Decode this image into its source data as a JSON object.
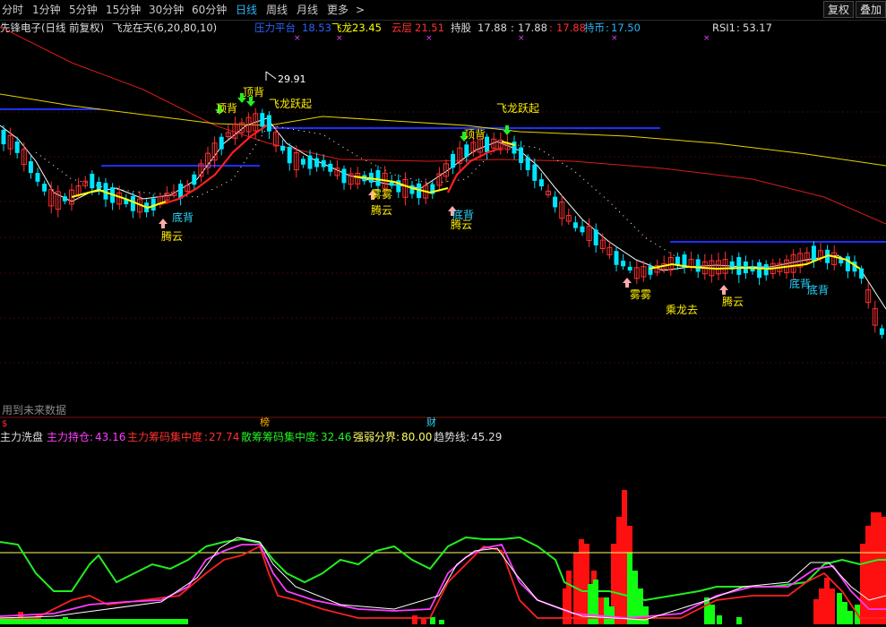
{
  "toolbar": {
    "periods": [
      "分时",
      "1分钟",
      "5分钟",
      "15分钟",
      "30分钟",
      "60分钟",
      "日线",
      "周线",
      "月线",
      "更多"
    ],
    "more_arrow": ">",
    "active_period": "日线",
    "restore_button": "复权",
    "overlay_button": "叠加"
  },
  "main": {
    "stock_title": "先锋电子(日线 前复权)",
    "indicator_name": "飞龙在天(6,20,80,10)",
    "values": {
      "pressure_label": "压力平台",
      "pressure_value": "18.53",
      "feilong_label": "飞龙",
      "feilong_value": "23.45",
      "yunceng_label": "云层",
      "yunceng_value": "21.51",
      "chigu_label": "持股",
      "chigu_value": "17.88",
      "chigu_value2": "17.88",
      "chigu_value3": "17.88",
      "chibi_label": "持币",
      "chibi_value": "17.50",
      "rsi_label": "RSI1",
      "rsi_value": "53.17"
    },
    "price_high_label": "29.91",
    "signal_labels": {
      "dingbei": "顶背",
      "dibei": "底背",
      "tengyun": "腾云",
      "feilong_yueqi": "飞龙跃起",
      "liaowu": "雾雾",
      "chenglongqu": "乘龙去"
    },
    "future_data_note": "用到未来数据",
    "pane_divider_marks": [
      "榜",
      "财"
    ],
    "colors": {
      "up": "#ff3030",
      "down": "#00e5ff",
      "red_line": "#ff2020",
      "yellow_line": "#ffff00",
      "white_line": "#ffffff",
      "slow_red": "#d81b1b",
      "slow_yellow": "#e6d200",
      "blue_platform": "#1e2fff"
    }
  },
  "sub": {
    "title": "主力洗盘",
    "legend": {
      "zhuli_label": "主力持仓",
      "zhuli_value": "43.16",
      "zhuli_chip_label": "主力筹码集中度",
      "zhuli_chip_value": "27.74",
      "sanhu_chip_label": "散筹筹码集中度",
      "sanhu_chip_value": "32.46",
      "strength_label": "强弱分界",
      "strength_value": "80.00",
      "trend_label": "趋势线",
      "trend_value": "45.29"
    },
    "colors": {
      "magenta": "#ff3cff",
      "red": "#ff2020",
      "green": "#22ee22",
      "yellow": "#ffff66",
      "white": "#ffffff",
      "bar_red": "#ff1010",
      "bar_green": "#10ff10"
    }
  }
}
